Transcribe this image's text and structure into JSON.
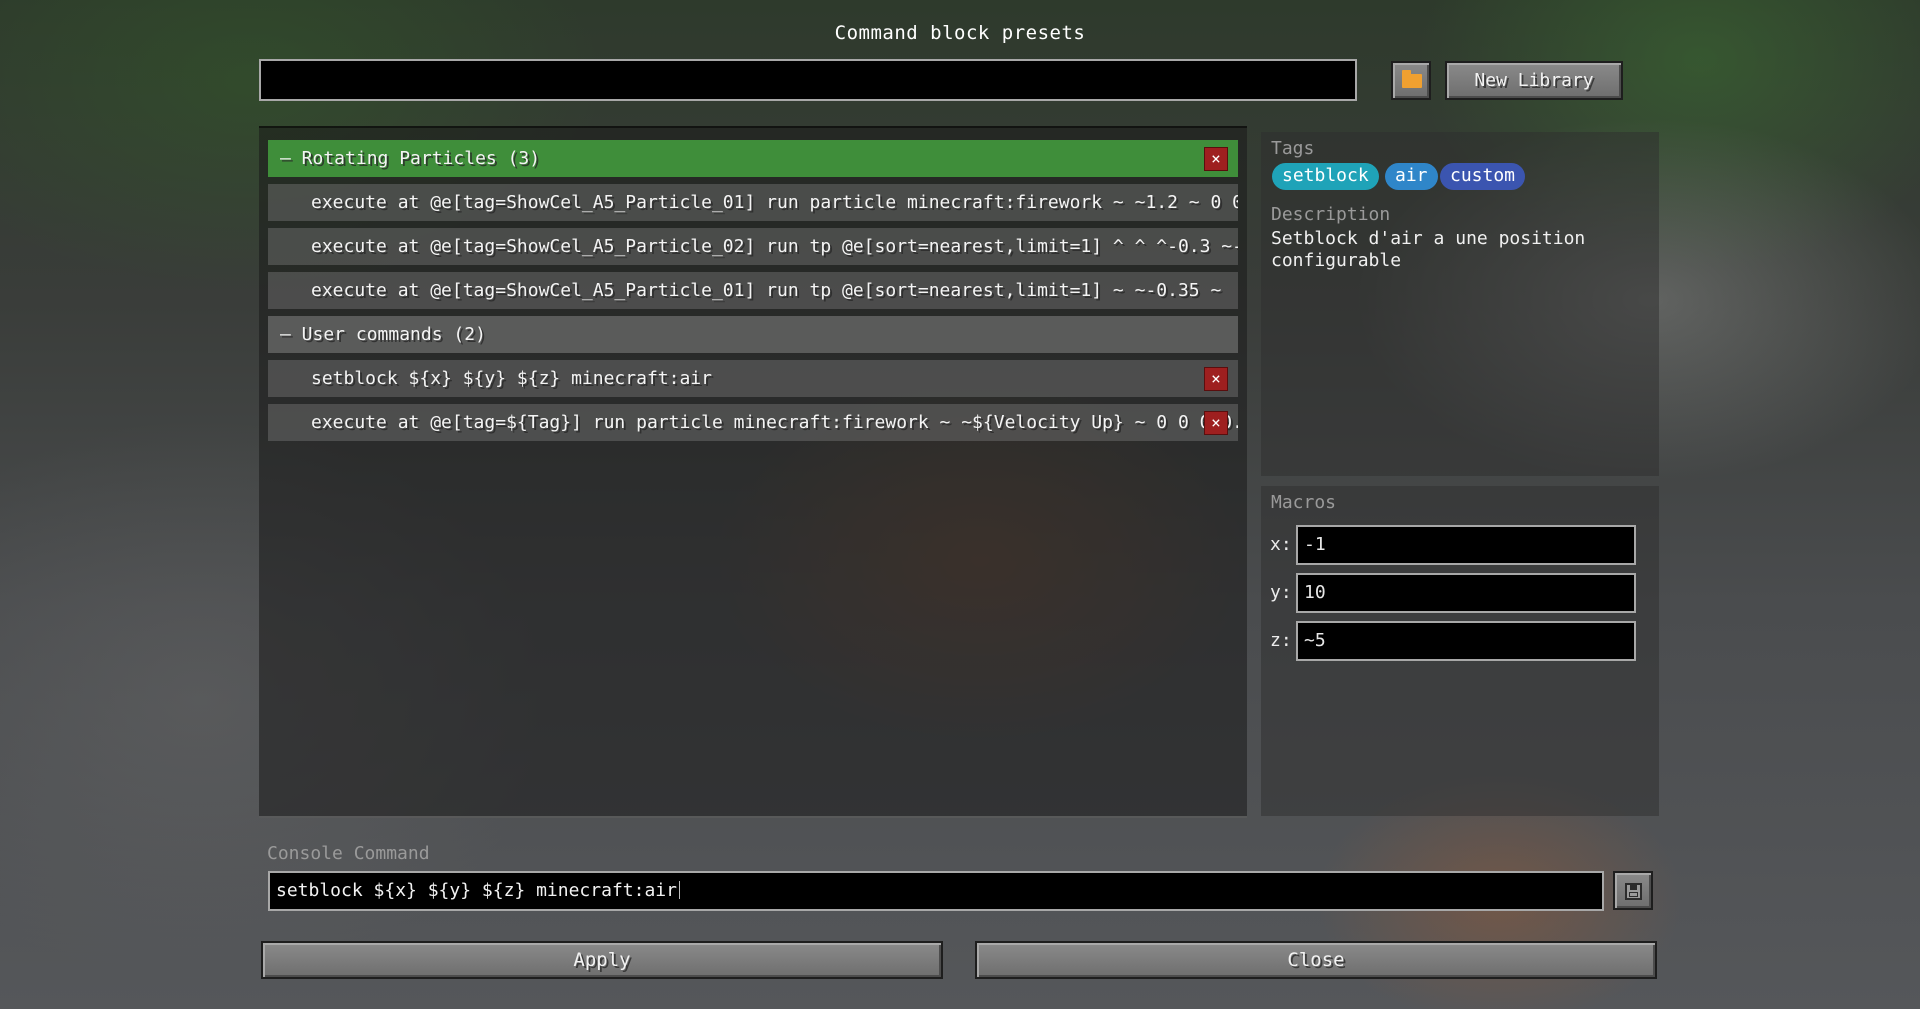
{
  "window": {
    "title": "Command block presets"
  },
  "search": {
    "value": ""
  },
  "toolbar": {
    "new_library_label": "New Library",
    "folder_icon": "folder-icon"
  },
  "presets": {
    "groups": [
      {
        "label": "– Rotating Particles (3)",
        "commands": [
          "execute at @e[tag=ShowCel_A5_Particle_01] run particle minecraft:firework ~ ~1.2 ~ 0 0 ...",
          "execute at @e[tag=ShowCel_A5_Particle_02] run tp @e[sort=nearest,limit=1] ^ ^ ^-0.3 ~-...",
          "execute at @e[tag=ShowCel_A5_Particle_01] run tp @e[sort=nearest,limit=1] ~ ~-0.35 ~"
        ]
      },
      {
        "label": "– User commands (2)",
        "commands": [
          "setblock ${x} ${y} ${z} minecraft:air",
          "execute at @e[tag=${Tag}] run particle minecraft:firework ~ ~${Velocity Up} ~ 0 0 0 0..."
        ]
      }
    ],
    "delete_symbol": "×"
  },
  "info": {
    "tags_label": "Tags",
    "tags": [
      {
        "name": "setblock",
        "color": "#1fa3b8"
      },
      {
        "name": "air",
        "color": "#2f86c9"
      },
      {
        "name": "custom",
        "color": "#3b55b0"
      }
    ],
    "description_label": "Description",
    "description": "Setblock d'air a une position configurable"
  },
  "macros": {
    "label": "Macros",
    "fields": [
      {
        "name": "x:",
        "value": "-1"
      },
      {
        "name": "y:",
        "value": "10"
      },
      {
        "name": "z:",
        "value": "~5"
      }
    ]
  },
  "console": {
    "label": "Console Command",
    "value": "setblock ${x} ${y} ${z} minecraft:air",
    "save_icon": "floppy-disk-icon"
  },
  "footer": {
    "apply_label": "Apply",
    "close_label": "Close"
  },
  "colors": {
    "selected_group": "#3f8e3a",
    "delete_button": "#9e1f1f"
  }
}
